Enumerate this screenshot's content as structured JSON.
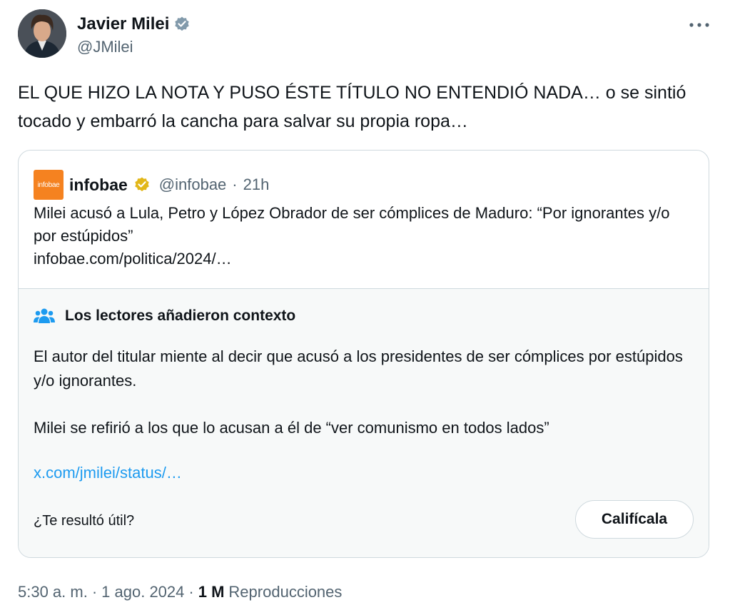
{
  "author": {
    "name": "Javier Milei",
    "handle": "@JMilei",
    "verified": true,
    "verified_color": "#829aab"
  },
  "tweet": {
    "text": "EL QUE HIZO LA NOTA Y PUSO ÉSTE TÍTULO NO ENTENDIÓ NADA… o se sintió tocado y embarró la cancha para salvar su propia ropa…"
  },
  "quote": {
    "logo_text": "infobae",
    "logo_color": "#f58220",
    "name": "infobae",
    "verified_color": "#e2b719",
    "handle": "@infobae",
    "separator": "·",
    "time": "21h",
    "headline": "Milei acusó a Lula, Petro y López Obrador de ser cómplices de Maduro: “Por ignorantes y/o por estúpidos”",
    "link": "infobae.com/politica/2024/…"
  },
  "community_note": {
    "icon": "people-icon",
    "icon_color": "#1d9bf0",
    "title": "Los lectores añadieron contexto",
    "paragraph1": "El autor del titular miente al decir que acusó a los presidentes de ser cómplices por estúpidos y/o ignorantes.",
    "paragraph2": "Milei se refirió a los que lo acusan a él de “ver comunismo en todos lados”",
    "link": "x.com/jmilei/status/…",
    "link_color": "#1d9bf0",
    "helpful_question": "¿Te resultó útil?",
    "rate_label": "Califícala"
  },
  "footer": {
    "time": "5:30 a. m.",
    "sep1": "·",
    "date": "1 ago. 2024",
    "sep2": "·",
    "views_count": "1 M",
    "views_label": "Reproducciones"
  }
}
